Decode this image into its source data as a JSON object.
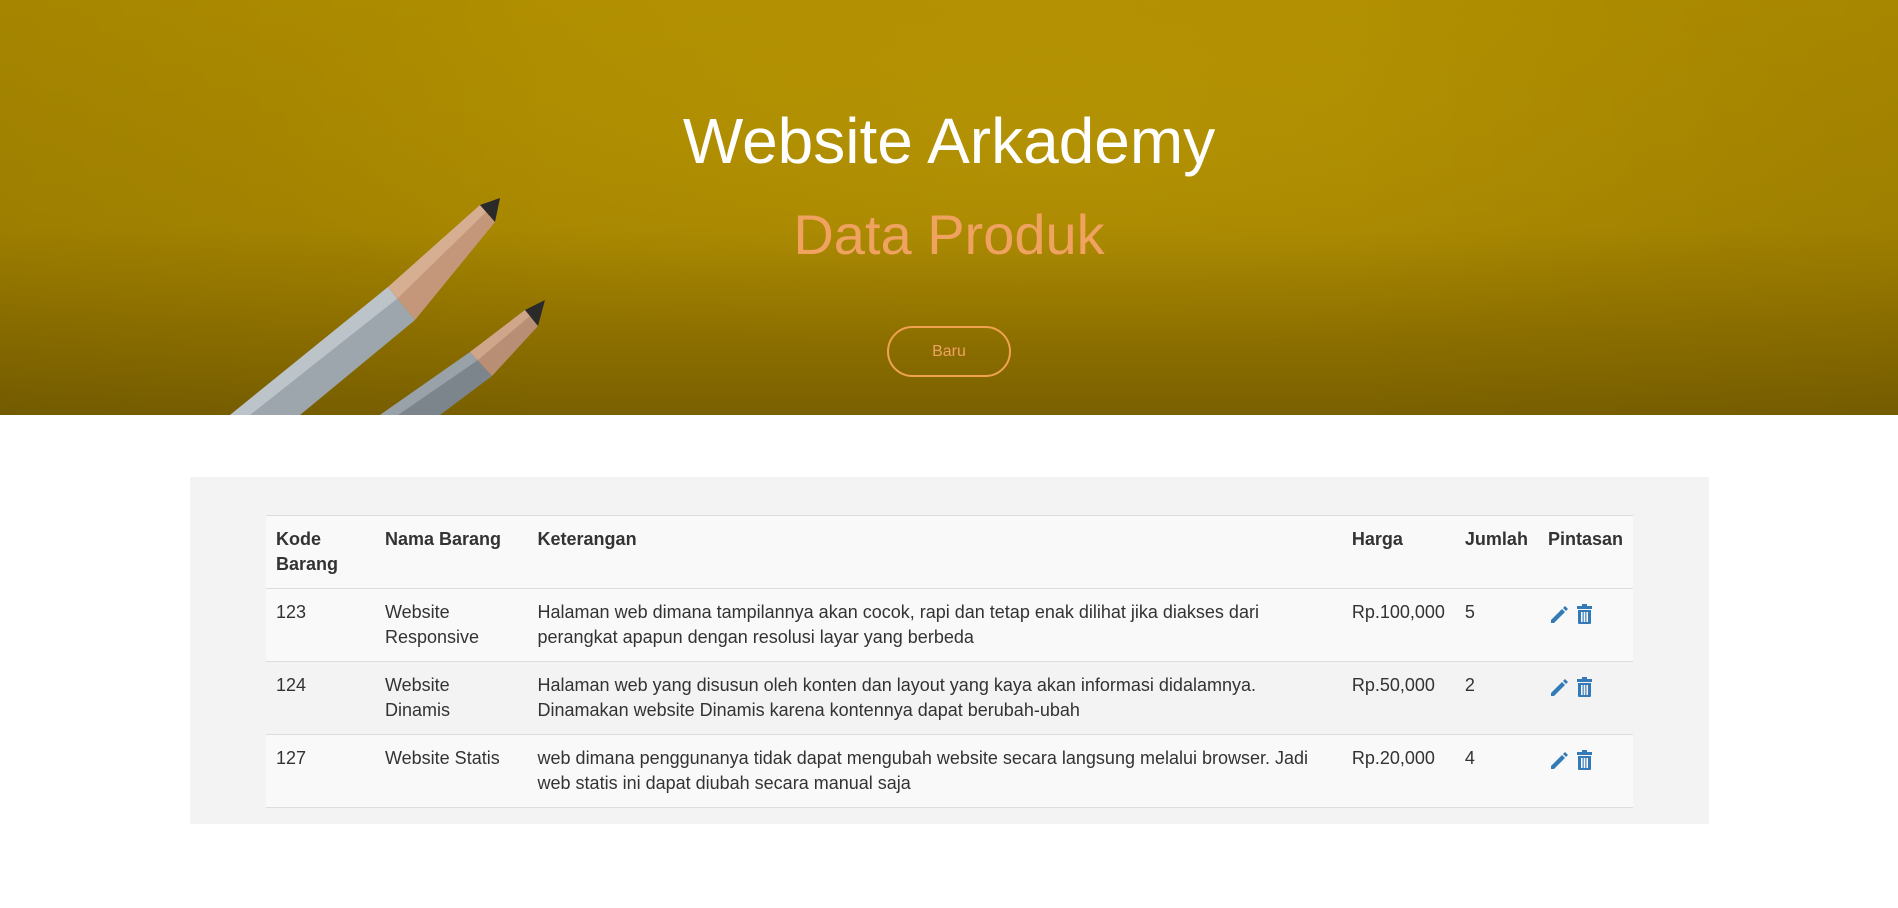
{
  "hero": {
    "title": "Website Arkademy",
    "subtitle": "Data Produk",
    "new_button_label": "Baru"
  },
  "colors": {
    "hero_background": "#a98800",
    "subtitle": "#f0a260",
    "button_border": "#f0a250",
    "panel_background": "#f3f3f3",
    "icon_blue": "#337ab7"
  },
  "table": {
    "headers": {
      "code": "Kode Barang",
      "name": "Nama Barang",
      "description": "Keterangan",
      "price": "Harga",
      "quantity": "Jumlah",
      "actions": "Pintasan"
    },
    "rows": [
      {
        "code": "123",
        "name": "Website Responsive",
        "description": "Halaman web dimana tampilannya akan cocok, rapi dan tetap enak dilihat jika diakses dari perangkat apapun dengan resolusi layar yang berbeda",
        "price": "Rp.100,000",
        "quantity": "5",
        "edit_icon": "pencil-icon",
        "delete_icon": "trash-icon"
      },
      {
        "code": "124",
        "name": "Website Dinamis",
        "description": "Halaman web yang disusun oleh konten dan layout yang kaya akan informasi didalamnya. Dinamakan website Dinamis karena kontennya dapat berubah-ubah",
        "price": "Rp.50,000",
        "quantity": "2",
        "edit_icon": "pencil-icon",
        "delete_icon": "trash-icon"
      },
      {
        "code": "127",
        "name": "Website Statis",
        "description": "web dimana penggunanya tidak dapat mengubah website secara langsung melalui browser. Jadi web statis ini dapat diubah secara manual saja",
        "price": "Rp.20,000",
        "quantity": "4",
        "edit_icon": "pencil-icon",
        "delete_icon": "trash-icon"
      }
    ]
  }
}
